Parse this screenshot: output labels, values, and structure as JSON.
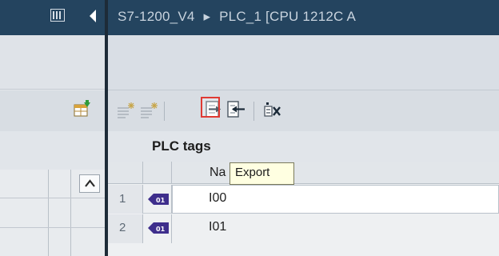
{
  "title_bar": {
    "segments": [
      "S7-1200_V4",
      "▸",
      "PLC_1 [CPU 1212C A"
    ]
  },
  "toolbar": {
    "buttons": [
      {
        "name": "add-row-icon"
      },
      {
        "name": "insert-row-icon"
      },
      {
        "name": "export-icon"
      },
      {
        "name": "import-icon"
      },
      {
        "name": "monitor-icon"
      }
    ]
  },
  "tags_table": {
    "title": "PLC tags",
    "columns": [
      "Na"
    ],
    "rows": [
      {
        "num": "1",
        "name": "I00"
      },
      {
        "num": "2",
        "name": "I01"
      }
    ]
  },
  "tooltip": {
    "text": "Export"
  }
}
